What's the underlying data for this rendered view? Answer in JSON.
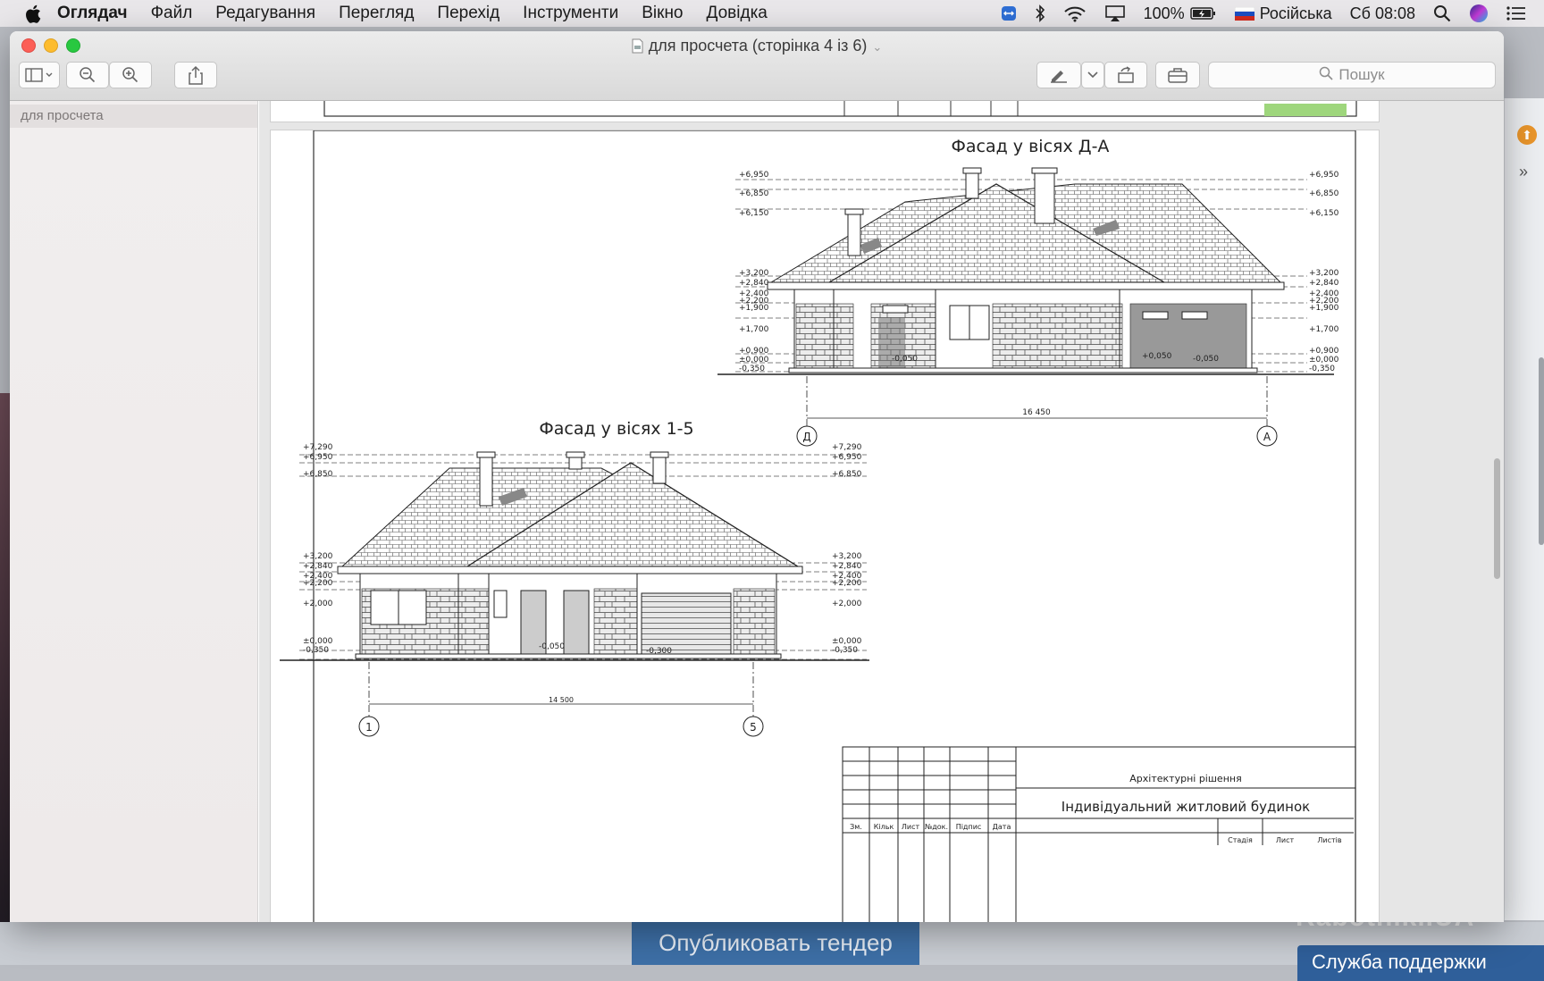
{
  "menubar": {
    "app_name": "Оглядач",
    "items": [
      "Файл",
      "Редагування",
      "Перегляд",
      "Перехід",
      "Інструменти",
      "Вікно",
      "Довідка"
    ],
    "battery": "100%",
    "input_language": "Російська",
    "clock": "Сб 08:08"
  },
  "window": {
    "title": "для просчета (сторінка 4 із 6)",
    "search_placeholder": "Пошук",
    "sidebar_item": "для просчета"
  },
  "drawing": {
    "facade1_title": "Фасад у вісях Д-А",
    "facade2_title": "Фасад у вісях 1-5",
    "facade1_levels_top": [
      "+6,950",
      "+6,850",
      "+6,150"
    ],
    "facade1_levels_mid": [
      "+3,200",
      "+2,840",
      "+2,400",
      "+2,200",
      "+1,900",
      "+1,700"
    ],
    "facade1_levels_low": [
      "+0,900",
      "±0,000",
      "-0,350"
    ],
    "facade1_floor_marks": [
      "-0,050",
      "+0,050",
      "-0,050"
    ],
    "facade1_dimension": "16 450",
    "facade1_axes": [
      "Д",
      "А"
    ],
    "facade2_levels_top": [
      "+7,290",
      "+6,950",
      "+6,850"
    ],
    "facade2_levels_mid": [
      "+3,200",
      "+2,840",
      "+2,400",
      "+2,200",
      "+2,000"
    ],
    "facade2_levels_low": [
      "±0,000",
      "-0,350"
    ],
    "facade2_floor_marks": [
      "-0,050",
      "-0,300"
    ],
    "facade2_dimension": "14 500",
    "facade2_axes": [
      "1",
      "5"
    ],
    "stamp": {
      "headers": [
        "Зм.",
        "Кільк",
        "Лист",
        "№док.",
        "Підпис",
        "Дата"
      ],
      "section": "Архітектурні рішення",
      "project": "Індивідуальний житловий будинок",
      "cells": [
        "Стадія",
        "Лист",
        "Листів"
      ]
    }
  },
  "background_page": {
    "publish_button": "Опубликовать тендер",
    "support_button": "Служба поддержки",
    "watermark": "Rabotniki.UA"
  }
}
